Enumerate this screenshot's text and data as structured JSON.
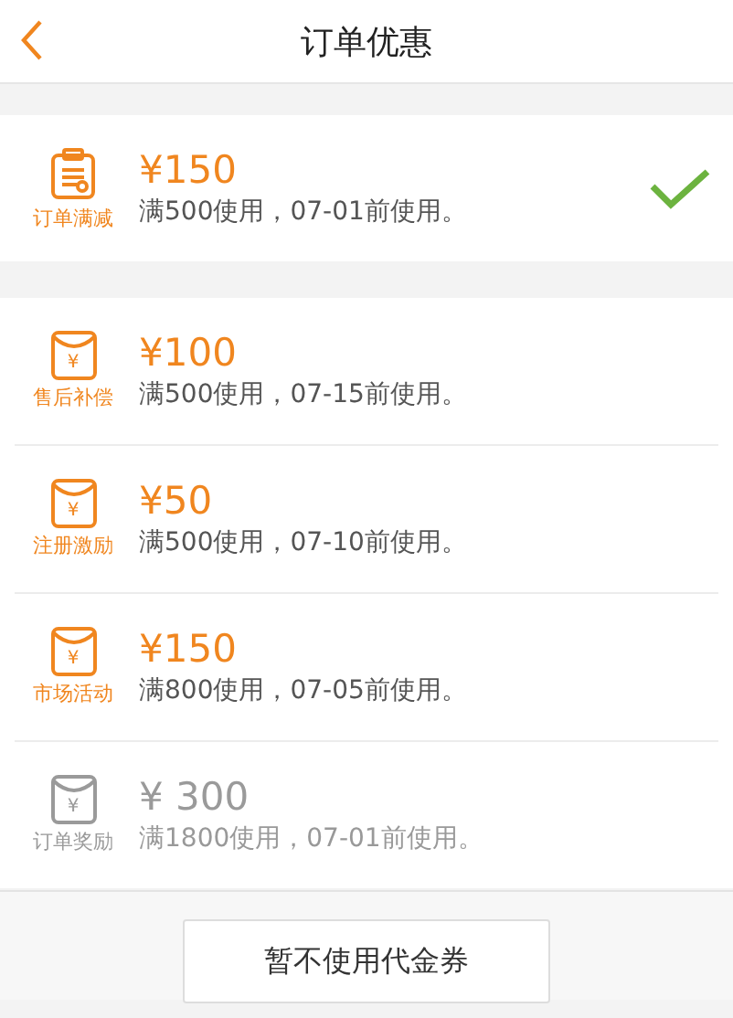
{
  "header": {
    "title": "订单优惠"
  },
  "sections": [
    {
      "coupons": [
        {
          "kind": "clipboard",
          "tag": "订单满减",
          "amount": "¥150",
          "condition": "满500使用，07-01前使用。",
          "selected": true,
          "disabled": false
        }
      ]
    },
    {
      "coupons": [
        {
          "kind": "envelope",
          "glyph": "¥",
          "tag": "售后补偿",
          "amount": "¥100",
          "condition": "满500使用，07-15前使用。",
          "selected": false,
          "disabled": false
        },
        {
          "kind": "envelope",
          "glyph": "¥",
          "tag": "注册激励",
          "amount": "¥50",
          "condition": "满500使用，07-10前使用。",
          "selected": false,
          "disabled": false
        },
        {
          "kind": "envelope",
          "glyph": "¥",
          "tag": "市场活动",
          "amount": "¥150",
          "condition": "满800使用，07-05前使用。",
          "selected": false,
          "disabled": false
        },
        {
          "kind": "envelope",
          "glyph": "¥",
          "tag": "订单奖励",
          "amount": "¥ 300",
          "condition": "满1800使用，07-01前使用。",
          "selected": false,
          "disabled": true
        }
      ]
    }
  ],
  "footer_button": "暂不使用代金券"
}
